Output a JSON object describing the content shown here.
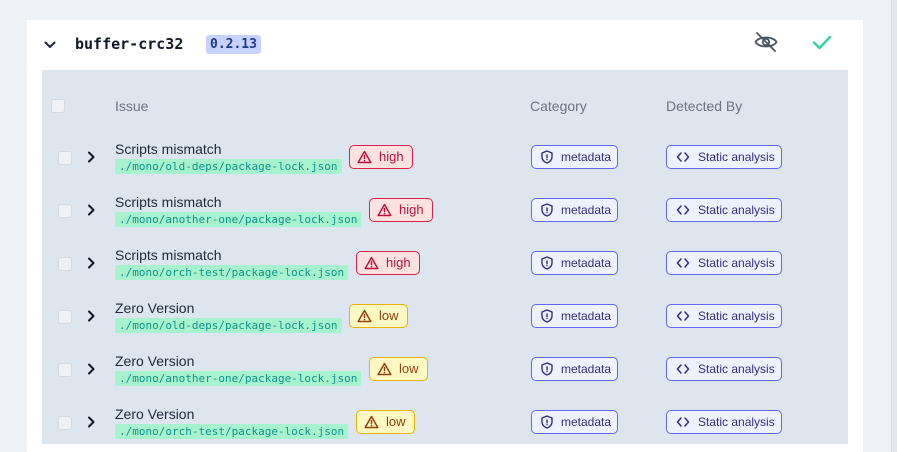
{
  "package": {
    "name": "buffer-crc32",
    "version": "0.2.13"
  },
  "icons": {
    "collapse": "chevron-down-icon",
    "hide": "eye-off-icon",
    "approve": "check-icon",
    "expand": "chevron-right-icon",
    "severity": "warning-triangle-icon",
    "category": "shield-icon",
    "detector": "code-brackets-icon"
  },
  "colors": {
    "accent_green": "#34d399",
    "high": "#e11d48",
    "low": "#eab308",
    "tag": "#6366f1",
    "path_bg": "#a7f3d0"
  },
  "table": {
    "headers": {
      "issue": "Issue",
      "category": "Category",
      "detected_by": "Detected By"
    },
    "rows": [
      {
        "title": "Scripts mismatch",
        "path": "./mono/old-deps/package-lock.json",
        "severity": "high",
        "category": "metadata",
        "detected_by": "Static analysis"
      },
      {
        "title": "Scripts mismatch",
        "path": "./mono/another-one/package-lock.json",
        "severity": "high",
        "category": "metadata",
        "detected_by": "Static analysis"
      },
      {
        "title": "Scripts mismatch",
        "path": "./mono/orch-test/package-lock.json",
        "severity": "high",
        "category": "metadata",
        "detected_by": "Static analysis"
      },
      {
        "title": "Zero Version",
        "path": "./mono/old-deps/package-lock.json",
        "severity": "low",
        "category": "metadata",
        "detected_by": "Static analysis"
      },
      {
        "title": "Zero Version",
        "path": "./mono/another-one/package-lock.json",
        "severity": "low",
        "category": "metadata",
        "detected_by": "Static analysis"
      },
      {
        "title": "Zero Version",
        "path": "./mono/orch-test/package-lock.json",
        "severity": "low",
        "category": "metadata",
        "detected_by": "Static analysis"
      }
    ]
  }
}
